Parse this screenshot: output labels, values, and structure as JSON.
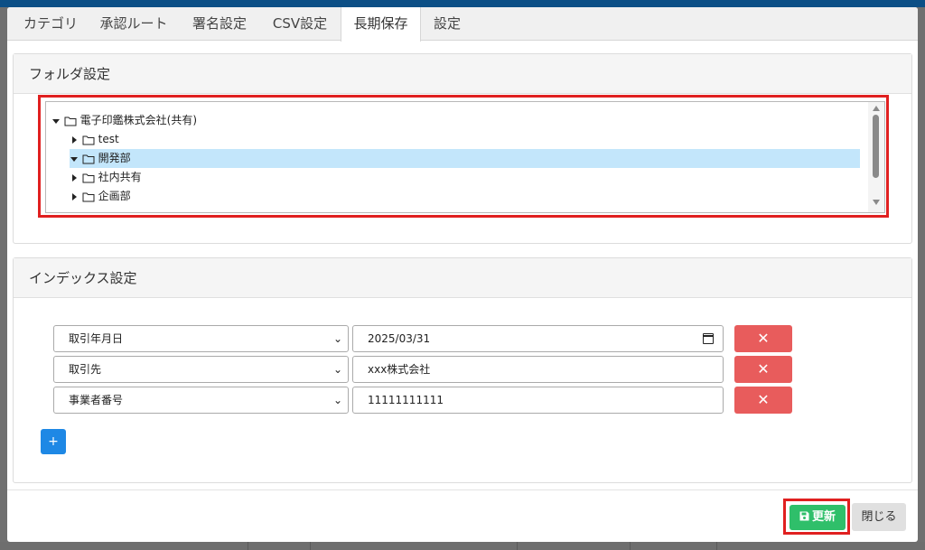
{
  "tabs": [
    "カテゴリ",
    "承認ルート",
    "署名設定",
    "CSV設定",
    "長期保存",
    "設定"
  ],
  "active_tab": "長期保存",
  "folder_panel": {
    "title": "フォルダ設定",
    "tree": [
      {
        "label": "電子印鑑株式会社(共有)",
        "expanded": true,
        "level": 0,
        "selected": false
      },
      {
        "label": "test",
        "expanded": false,
        "level": 1,
        "selected": false
      },
      {
        "label": "開発部",
        "expanded": true,
        "level": 1,
        "selected": true
      },
      {
        "label": "社内共有",
        "expanded": false,
        "level": 1,
        "selected": false
      },
      {
        "label": "企画部",
        "expanded": false,
        "level": 1,
        "selected": false
      }
    ]
  },
  "index_panel": {
    "title": "インデックス設定",
    "rows": [
      {
        "field": "取引年月日",
        "value": "2025/03/31",
        "input_type": "date"
      },
      {
        "field": "取引先",
        "value": "xxx株式会社",
        "input_type": "text"
      },
      {
        "field": "事業者番号",
        "value": "11111111111",
        "input_type": "text"
      }
    ],
    "delete_label": "✕",
    "add_label": "+"
  },
  "footer": {
    "save_label": "更新",
    "close_label": "閉じる"
  },
  "colors": {
    "delete": "#e85c5c",
    "add": "#1e88e5",
    "save": "#2fbf6a",
    "highlight": "#e02020",
    "selected_row": "#c3e6fb"
  }
}
